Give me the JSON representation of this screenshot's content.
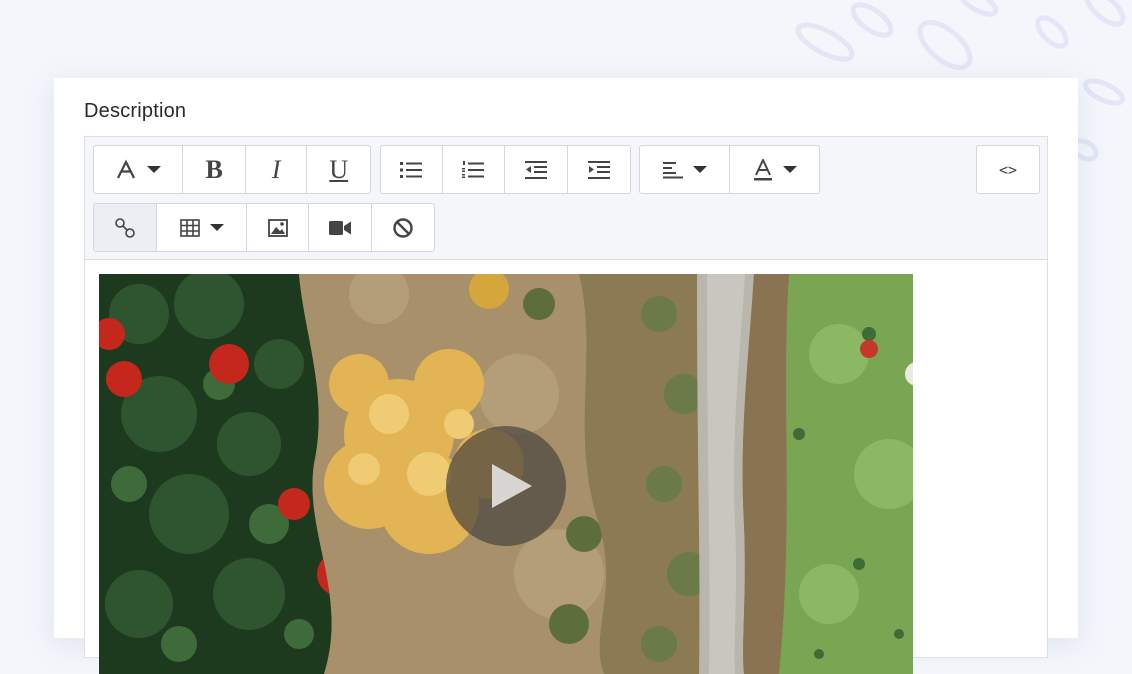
{
  "field": {
    "label": "Description"
  },
  "toolbar": {
    "font_icon": "font-icon",
    "bold_glyph": "B",
    "italic_glyph": "I",
    "underline_glyph": "U",
    "code_view_label": "<>"
  },
  "content": {
    "media": "aerial-forest-video",
    "play_icon": "play-icon"
  },
  "colors": {
    "page_bg": "#f4f6fc",
    "card_bg": "#ffffff",
    "toolbar_bg": "#f5f6f9",
    "border": "#dcdfe6",
    "text": "#2a2a2a"
  }
}
